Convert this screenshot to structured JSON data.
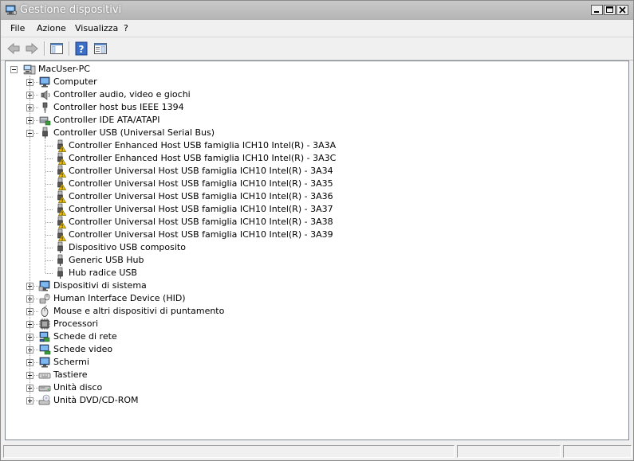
{
  "window": {
    "title": "Gestione dispositivi",
    "buttons": {
      "minimize": "minimize",
      "maximize": "maximize",
      "close": "close"
    }
  },
  "menu": [
    "File",
    "Azione",
    "Visualizza",
    "?"
  ],
  "toolbar": {
    "icons": [
      "back-arrow-icon",
      "forward-arrow-icon",
      "show-hide-console-tree-icon",
      "help-icon",
      "properties-icon"
    ]
  },
  "tree": {
    "root": "MacUser-PC",
    "categories_before": [
      {
        "label": "Computer",
        "icon": "computer-icon"
      },
      {
        "label": "Controller audio, video e giochi",
        "icon": "speaker-icon"
      },
      {
        "label": "Controller host bus IEEE 1394",
        "icon": "firewire-plug-icon"
      },
      {
        "label": "Controller IDE ATA/ATAPI",
        "icon": "ide-controller-icon"
      }
    ],
    "usb_category": {
      "label": "Controller USB (Universal Serial Bus)",
      "children": [
        {
          "label": "Controller Enhanced Host USB famiglia ICH10 Intel(R) - 3A3A",
          "warning": true
        },
        {
          "label": "Controller Enhanced Host USB famiglia ICH10 Intel(R) - 3A3C",
          "warning": true
        },
        {
          "label": "Controller Universal Host USB famiglia ICH10 Intel(R) - 3A34",
          "warning": true
        },
        {
          "label": "Controller Universal Host USB famiglia ICH10 Intel(R) - 3A35",
          "warning": true
        },
        {
          "label": "Controller Universal Host USB famiglia ICH10 Intel(R) - 3A36",
          "warning": true
        },
        {
          "label": "Controller Universal Host USB famiglia ICH10 Intel(R) - 3A37",
          "warning": true
        },
        {
          "label": "Controller Universal Host USB famiglia ICH10 Intel(R) - 3A38",
          "warning": true
        },
        {
          "label": "Controller Universal Host USB famiglia ICH10 Intel(R) - 3A39",
          "warning": true
        },
        {
          "label": "Dispositivo USB composito",
          "warning": false
        },
        {
          "label": "Generic USB Hub",
          "warning": false
        },
        {
          "label": "Hub radice USB",
          "warning": false
        }
      ]
    },
    "categories_after": [
      {
        "label": "Dispositivi di sistema",
        "icon": "system-devices-icon"
      },
      {
        "label": "Human Interface Device (HID)",
        "icon": "hid-icon"
      },
      {
        "label": "Mouse e altri dispositivi di puntamento",
        "icon": "mouse-icon"
      },
      {
        "label": "Processori",
        "icon": "processor-icon"
      },
      {
        "label": "Schede di rete",
        "icon": "network-adapter-icon"
      },
      {
        "label": "Schede video",
        "icon": "display-adapter-icon"
      },
      {
        "label": "Schermi",
        "icon": "monitor-icon"
      },
      {
        "label": "Tastiere",
        "icon": "keyboard-icon"
      },
      {
        "label": "Unità disco",
        "icon": "disk-drive-icon"
      },
      {
        "label": "Unità DVD/CD-ROM",
        "icon": "dvd-drive-icon"
      }
    ]
  },
  "colors": {
    "warning": "#f5c400",
    "title_bar": "#c0c0c0",
    "window_bg": "#f0f0f0"
  }
}
